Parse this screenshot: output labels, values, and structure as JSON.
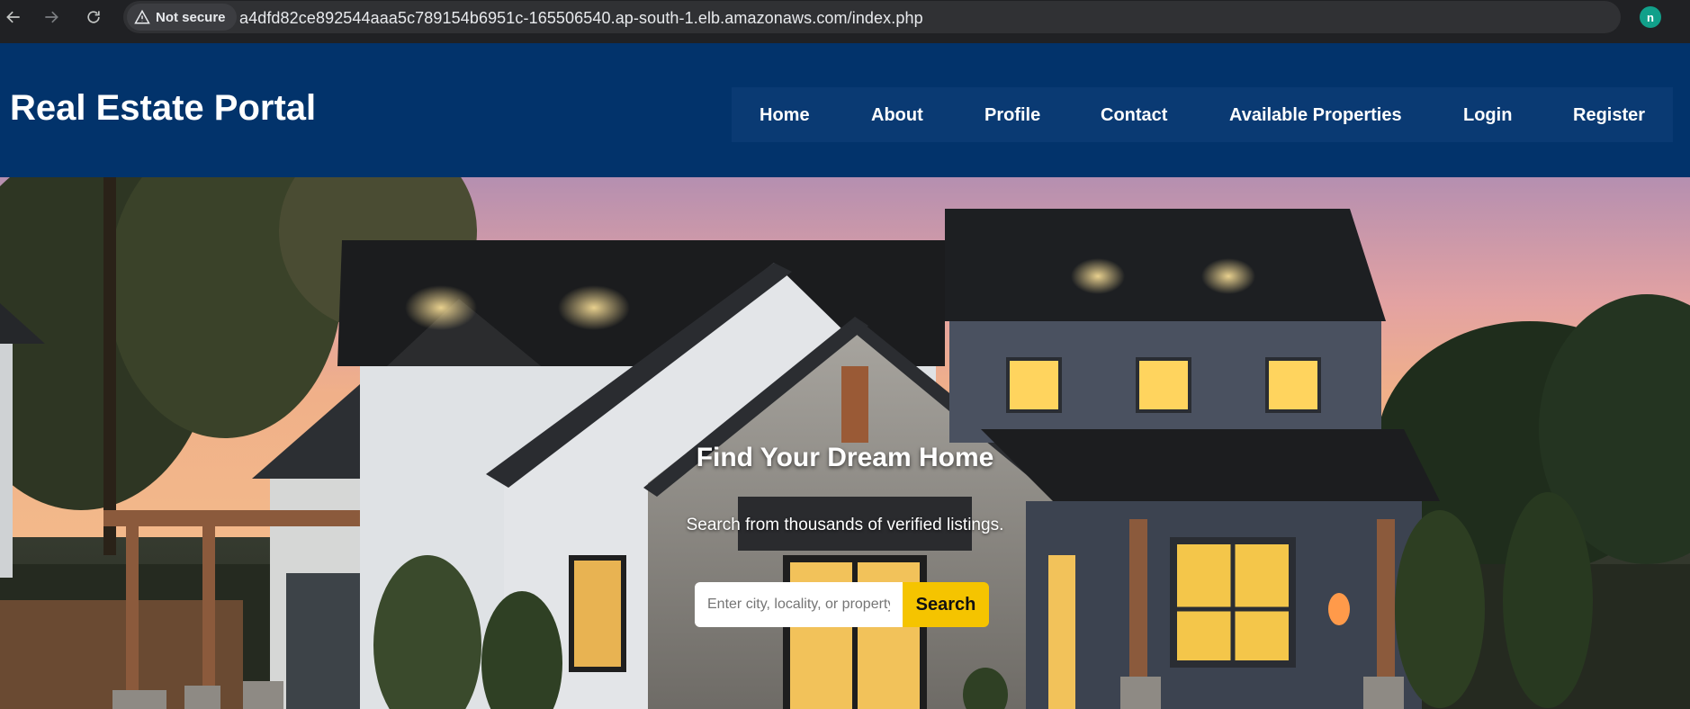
{
  "browser": {
    "security_label": "Not secure",
    "url": "a4dfd82ce892544aaa5c789154b6951c-165506540.ap-south-1.elb.amazonaws.com/index.php",
    "profile_initial": "n",
    "icons": [
      "back-arrow-icon",
      "forward-arrow-icon",
      "reload-icon",
      "warning-icon",
      "star-icon"
    ]
  },
  "header": {
    "site_title": "Real Estate Portal",
    "nav": [
      {
        "label": "Home"
      },
      {
        "label": "About"
      },
      {
        "label": "Profile"
      },
      {
        "label": "Contact"
      },
      {
        "label": "Available Properties"
      },
      {
        "label": "Login"
      },
      {
        "label": "Register"
      }
    ]
  },
  "hero": {
    "title": "Find Your Dream Home",
    "subtitle": "Search from thousands of verified listings.",
    "search": {
      "placeholder": "Enter city, locality, or property",
      "button_label": "Search"
    }
  },
  "colors": {
    "header_bg": "#02336b",
    "nav_bg": "#0a3a73",
    "search_button": "#f5c400"
  }
}
